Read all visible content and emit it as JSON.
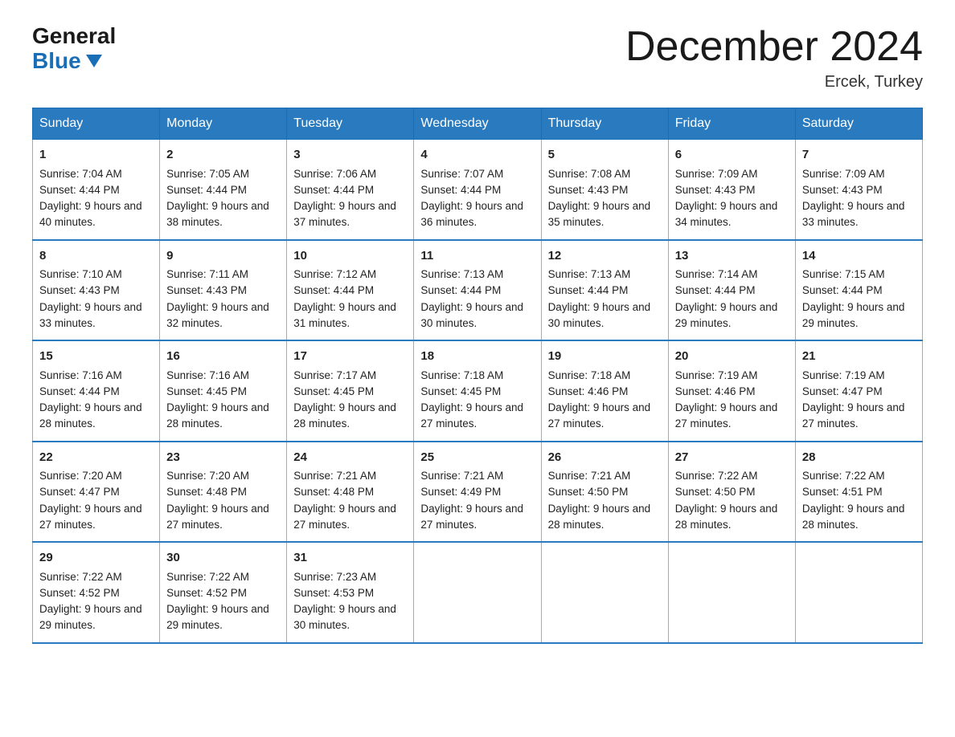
{
  "logo": {
    "general": "General",
    "blue": "Blue"
  },
  "title": "December 2024",
  "location": "Ercek, Turkey",
  "days_of_week": [
    "Sunday",
    "Monday",
    "Tuesday",
    "Wednesday",
    "Thursday",
    "Friday",
    "Saturday"
  ],
  "weeks": [
    [
      {
        "day": "1",
        "sunrise": "Sunrise: 7:04 AM",
        "sunset": "Sunset: 4:44 PM",
        "daylight": "Daylight: 9 hours and 40 minutes."
      },
      {
        "day": "2",
        "sunrise": "Sunrise: 7:05 AM",
        "sunset": "Sunset: 4:44 PM",
        "daylight": "Daylight: 9 hours and 38 minutes."
      },
      {
        "day": "3",
        "sunrise": "Sunrise: 7:06 AM",
        "sunset": "Sunset: 4:44 PM",
        "daylight": "Daylight: 9 hours and 37 minutes."
      },
      {
        "day": "4",
        "sunrise": "Sunrise: 7:07 AM",
        "sunset": "Sunset: 4:44 PM",
        "daylight": "Daylight: 9 hours and 36 minutes."
      },
      {
        "day": "5",
        "sunrise": "Sunrise: 7:08 AM",
        "sunset": "Sunset: 4:43 PM",
        "daylight": "Daylight: 9 hours and 35 minutes."
      },
      {
        "day": "6",
        "sunrise": "Sunrise: 7:09 AM",
        "sunset": "Sunset: 4:43 PM",
        "daylight": "Daylight: 9 hours and 34 minutes."
      },
      {
        "day": "7",
        "sunrise": "Sunrise: 7:09 AM",
        "sunset": "Sunset: 4:43 PM",
        "daylight": "Daylight: 9 hours and 33 minutes."
      }
    ],
    [
      {
        "day": "8",
        "sunrise": "Sunrise: 7:10 AM",
        "sunset": "Sunset: 4:43 PM",
        "daylight": "Daylight: 9 hours and 33 minutes."
      },
      {
        "day": "9",
        "sunrise": "Sunrise: 7:11 AM",
        "sunset": "Sunset: 4:43 PM",
        "daylight": "Daylight: 9 hours and 32 minutes."
      },
      {
        "day": "10",
        "sunrise": "Sunrise: 7:12 AM",
        "sunset": "Sunset: 4:44 PM",
        "daylight": "Daylight: 9 hours and 31 minutes."
      },
      {
        "day": "11",
        "sunrise": "Sunrise: 7:13 AM",
        "sunset": "Sunset: 4:44 PM",
        "daylight": "Daylight: 9 hours and 30 minutes."
      },
      {
        "day": "12",
        "sunrise": "Sunrise: 7:13 AM",
        "sunset": "Sunset: 4:44 PM",
        "daylight": "Daylight: 9 hours and 30 minutes."
      },
      {
        "day": "13",
        "sunrise": "Sunrise: 7:14 AM",
        "sunset": "Sunset: 4:44 PM",
        "daylight": "Daylight: 9 hours and 29 minutes."
      },
      {
        "day": "14",
        "sunrise": "Sunrise: 7:15 AM",
        "sunset": "Sunset: 4:44 PM",
        "daylight": "Daylight: 9 hours and 29 minutes."
      }
    ],
    [
      {
        "day": "15",
        "sunrise": "Sunrise: 7:16 AM",
        "sunset": "Sunset: 4:44 PM",
        "daylight": "Daylight: 9 hours and 28 minutes."
      },
      {
        "day": "16",
        "sunrise": "Sunrise: 7:16 AM",
        "sunset": "Sunset: 4:45 PM",
        "daylight": "Daylight: 9 hours and 28 minutes."
      },
      {
        "day": "17",
        "sunrise": "Sunrise: 7:17 AM",
        "sunset": "Sunset: 4:45 PM",
        "daylight": "Daylight: 9 hours and 28 minutes."
      },
      {
        "day": "18",
        "sunrise": "Sunrise: 7:18 AM",
        "sunset": "Sunset: 4:45 PM",
        "daylight": "Daylight: 9 hours and 27 minutes."
      },
      {
        "day": "19",
        "sunrise": "Sunrise: 7:18 AM",
        "sunset": "Sunset: 4:46 PM",
        "daylight": "Daylight: 9 hours and 27 minutes."
      },
      {
        "day": "20",
        "sunrise": "Sunrise: 7:19 AM",
        "sunset": "Sunset: 4:46 PM",
        "daylight": "Daylight: 9 hours and 27 minutes."
      },
      {
        "day": "21",
        "sunrise": "Sunrise: 7:19 AM",
        "sunset": "Sunset: 4:47 PM",
        "daylight": "Daylight: 9 hours and 27 minutes."
      }
    ],
    [
      {
        "day": "22",
        "sunrise": "Sunrise: 7:20 AM",
        "sunset": "Sunset: 4:47 PM",
        "daylight": "Daylight: 9 hours and 27 minutes."
      },
      {
        "day": "23",
        "sunrise": "Sunrise: 7:20 AM",
        "sunset": "Sunset: 4:48 PM",
        "daylight": "Daylight: 9 hours and 27 minutes."
      },
      {
        "day": "24",
        "sunrise": "Sunrise: 7:21 AM",
        "sunset": "Sunset: 4:48 PM",
        "daylight": "Daylight: 9 hours and 27 minutes."
      },
      {
        "day": "25",
        "sunrise": "Sunrise: 7:21 AM",
        "sunset": "Sunset: 4:49 PM",
        "daylight": "Daylight: 9 hours and 27 minutes."
      },
      {
        "day": "26",
        "sunrise": "Sunrise: 7:21 AM",
        "sunset": "Sunset: 4:50 PM",
        "daylight": "Daylight: 9 hours and 28 minutes."
      },
      {
        "day": "27",
        "sunrise": "Sunrise: 7:22 AM",
        "sunset": "Sunset: 4:50 PM",
        "daylight": "Daylight: 9 hours and 28 minutes."
      },
      {
        "day": "28",
        "sunrise": "Sunrise: 7:22 AM",
        "sunset": "Sunset: 4:51 PM",
        "daylight": "Daylight: 9 hours and 28 minutes."
      }
    ],
    [
      {
        "day": "29",
        "sunrise": "Sunrise: 7:22 AM",
        "sunset": "Sunset: 4:52 PM",
        "daylight": "Daylight: 9 hours and 29 minutes."
      },
      {
        "day": "30",
        "sunrise": "Sunrise: 7:22 AM",
        "sunset": "Sunset: 4:52 PM",
        "daylight": "Daylight: 9 hours and 29 minutes."
      },
      {
        "day": "31",
        "sunrise": "Sunrise: 7:23 AM",
        "sunset": "Sunset: 4:53 PM",
        "daylight": "Daylight: 9 hours and 30 minutes."
      },
      null,
      null,
      null,
      null
    ]
  ]
}
